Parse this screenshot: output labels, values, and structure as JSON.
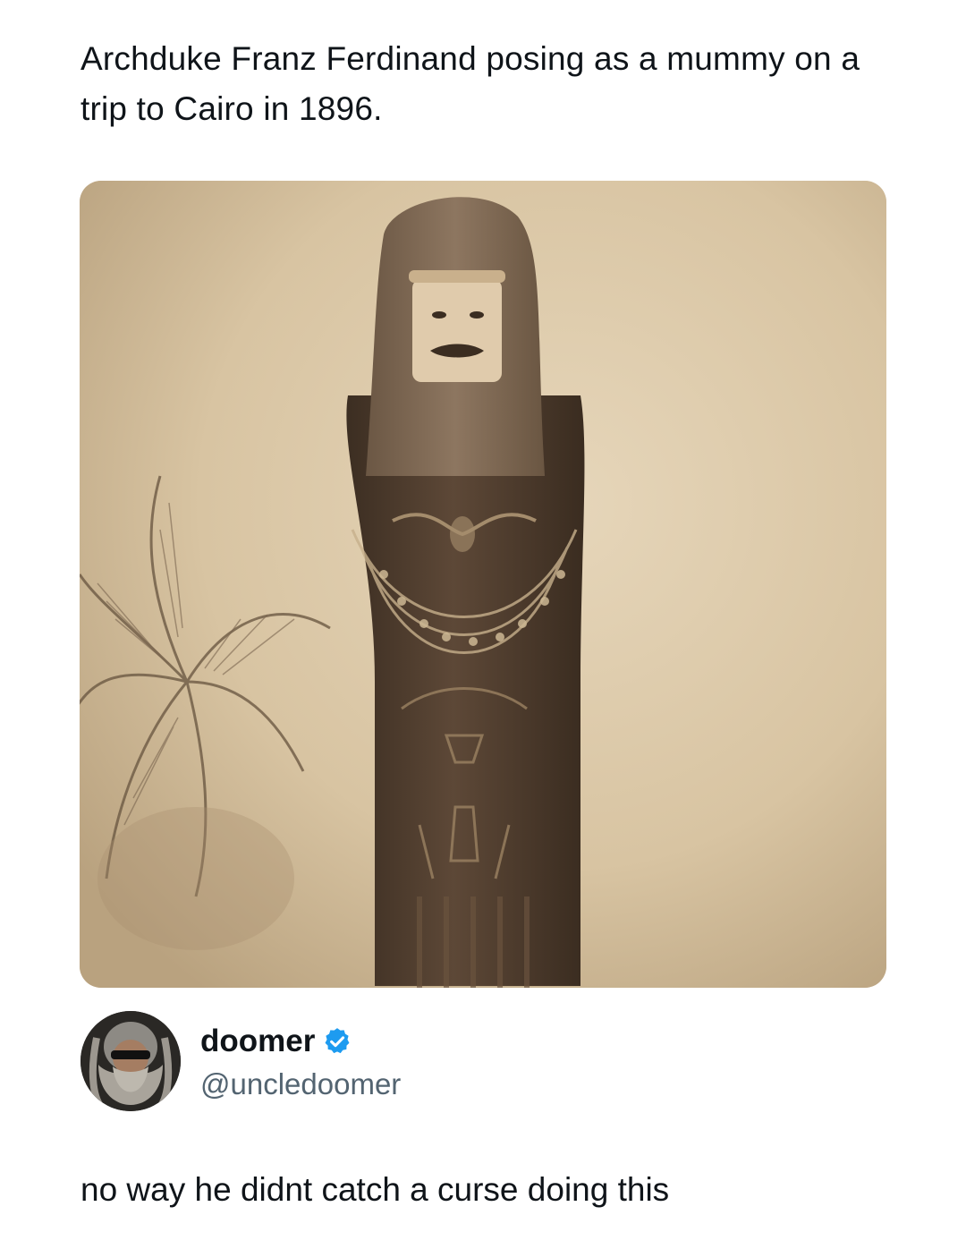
{
  "quoted": {
    "text": "Archduke Franz Ferdinand posing as a mummy on a trip to Cairo in 1896."
  },
  "photo": {
    "icon": "sepia-photo-mummy-sarcophagus"
  },
  "author": {
    "display_name": "doomer",
    "handle": "@uncledoomer",
    "verified": true,
    "avatar_icon": "bearded-man-sunglasses-avatar"
  },
  "tweet": {
    "text": "no way he didnt catch a curse doing this"
  },
  "colors": {
    "text": "#0f1419",
    "handle": "#536471",
    "verified_badge": "#1d9bf0",
    "photo_sepia": "#d8c6a6"
  }
}
